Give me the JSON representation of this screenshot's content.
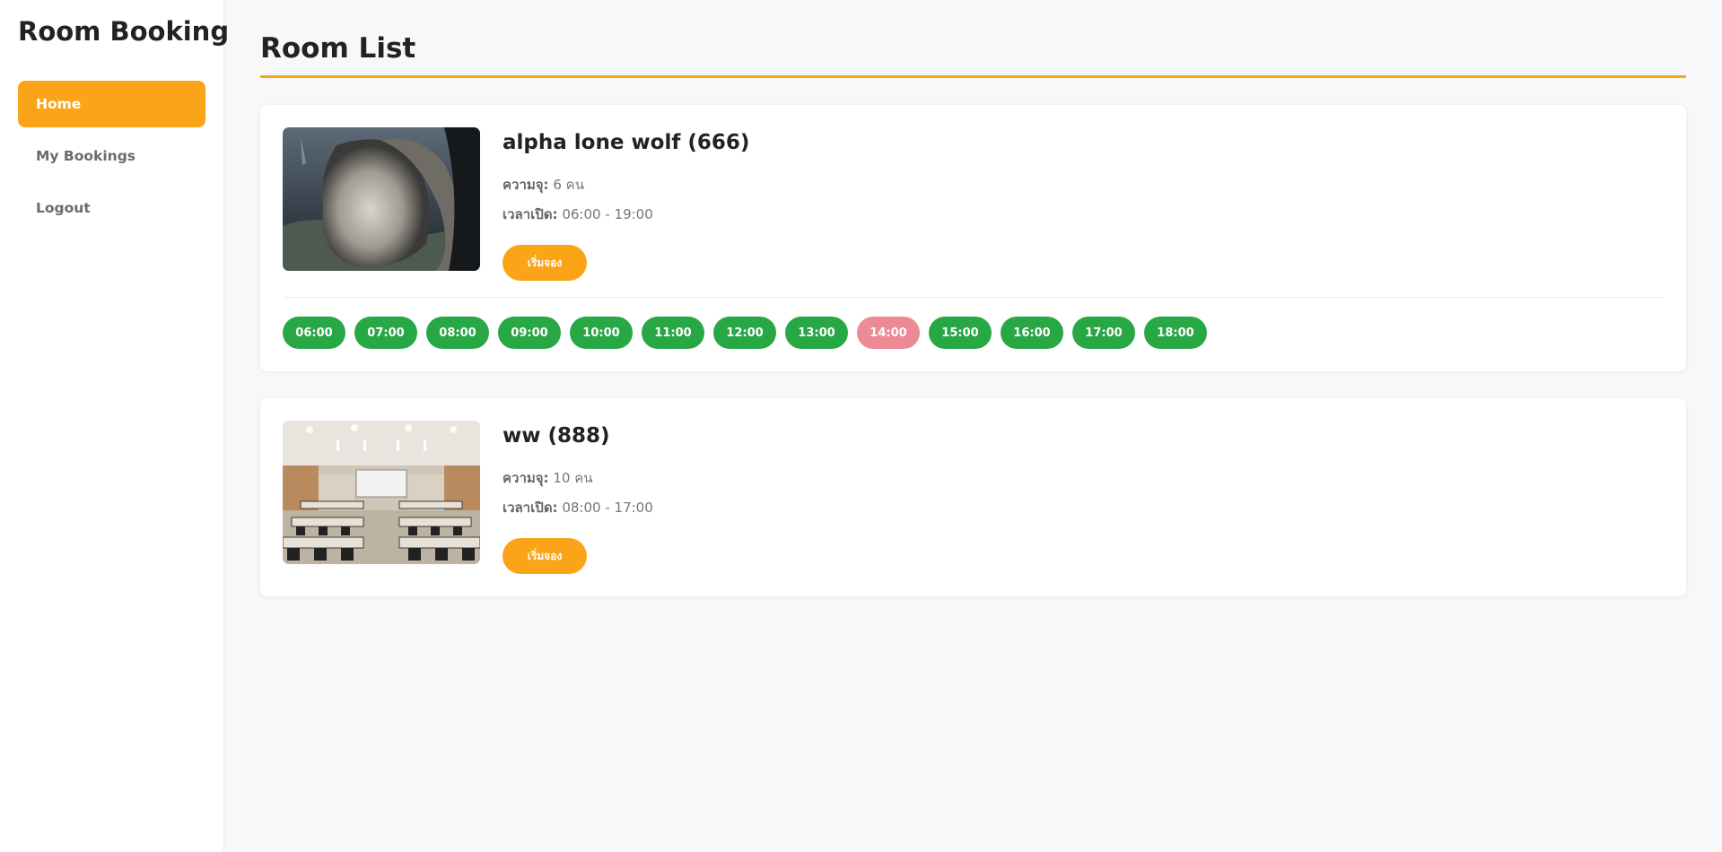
{
  "sidebar": {
    "brand": "Room Booking",
    "items": [
      {
        "label": "Home"
      },
      {
        "label": "My Bookings"
      },
      {
        "label": "Logout"
      }
    ]
  },
  "main": {
    "title": "Room List",
    "rooms": [
      {
        "name": "alpha lone wolf (666)",
        "capacity_label": "ความจุ:",
        "capacity_value": "6 คน",
        "hours_label": "เวลาเปิด:",
        "hours_value": "06:00 - 19:00",
        "book_label": "เริ่มจอง",
        "slots": [
          {
            "time": "06:00",
            "status": "available"
          },
          {
            "time": "07:00",
            "status": "available"
          },
          {
            "time": "08:00",
            "status": "available"
          },
          {
            "time": "09:00",
            "status": "available"
          },
          {
            "time": "10:00",
            "status": "available"
          },
          {
            "time": "11:00",
            "status": "available"
          },
          {
            "time": "12:00",
            "status": "available"
          },
          {
            "time": "13:00",
            "status": "available"
          },
          {
            "time": "14:00",
            "status": "booked"
          },
          {
            "time": "15:00",
            "status": "available"
          },
          {
            "time": "16:00",
            "status": "available"
          },
          {
            "time": "17:00",
            "status": "available"
          },
          {
            "time": "18:00",
            "status": "available"
          }
        ]
      },
      {
        "name": "ww (888)",
        "capacity_label": "ความจุ:",
        "capacity_value": "10 คน",
        "hours_label": "เวลาเปิด:",
        "hours_value": "08:00 - 17:00",
        "book_label": "เริ่มจอง"
      }
    ]
  },
  "colors": {
    "accent": "#fba418",
    "available": "#28a745",
    "booked": "#ec8a95"
  }
}
